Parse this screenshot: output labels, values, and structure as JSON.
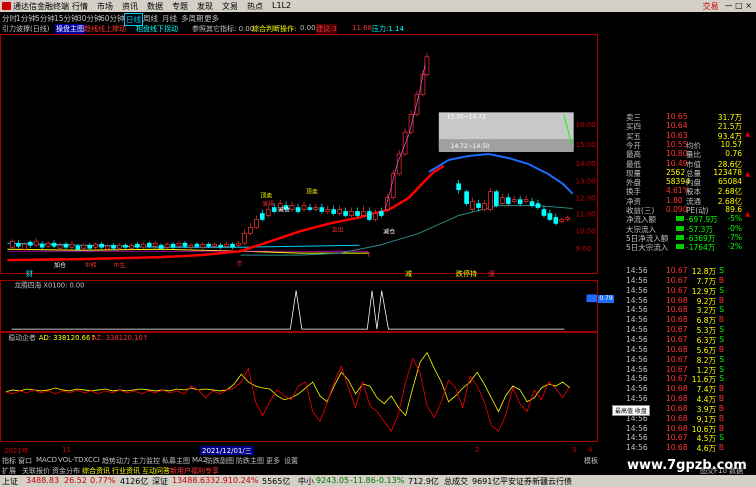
{
  "titlebar": {
    "app_title": "通达信金融终端",
    "menu": [
      "行情",
      "市场",
      "资讯",
      "数据",
      "专题",
      "发现",
      "文易",
      "热点",
      "L1L2"
    ],
    "right": "交易",
    "win_controls": "—  □  ×"
  },
  "periods": [
    "分时",
    "1分钟",
    "5分钟",
    "15分钟",
    "30分钟",
    "60分钟",
    "日线",
    "周线",
    "月线",
    "多周期",
    "更多"
  ],
  "selected_period": "日线",
  "indicator_bar": {
    "name": "引力波撑(日线)",
    "label1": "操盘主图",
    "label2": "趋线线上撑动",
    "label3": "相盘线下拐动",
    "label4": "参照其它指标: 0.00",
    "label5": "综合判断操作:",
    "label6": "0.00",
    "label7": "建议:3",
    "label8": "11.68",
    "label9": "压力:1.14"
  },
  "main_chart": {
    "price_axis": [
      "16.00",
      "15.00",
      "14.00",
      "13.00",
      "12.00",
      "11.00",
      "10.00",
      "9.00"
    ],
    "box1_label": "15.35~14.72",
    "box2_label": "14.72~14.50",
    "annotations": [
      "顶卖",
      "顶卖",
      "减仓",
      "波段",
      "减仓",
      "中转",
      "中生",
      "庄",
      "正出",
      "加仓"
    ],
    "bottom_labels": [
      "财",
      "减",
      "跌停持",
      "涨"
    ]
  },
  "sub1": {
    "title": "龙腾四海 X0100: 0.00",
    "axis": [
      "0.79"
    ]
  },
  "sub2": {
    "title": "稳动企者",
    "ad_label": "AD: 338120.66↑",
    "az_label": "AZ: 338120.10↑",
    "axis": [
      "10000",
      "5000",
      "0",
      "-5000"
    ]
  },
  "time_axis": {
    "left": "2021年",
    "mid1": "11",
    "mid2": "2021/12/01/三",
    "mid3": "2",
    "mid4": "3",
    "right": "4"
  },
  "quote": {
    "rows": [
      {
        "label": "卖三",
        "price": "10.65",
        "vol": "31.7万"
      },
      {
        "label": "买四",
        "price": "10.64",
        "vol": "21.5万"
      },
      {
        "label": "买五",
        "price": "10.63",
        "vol": "93.4万"
      },
      {
        "label": "今开",
        "price": "10.55",
        "label2": "均价",
        "val2": "10.57"
      },
      {
        "label": "最高",
        "price": "10.80",
        "label2": "量比",
        "val2": "0.76"
      },
      {
        "label": "最低",
        "price": "10.49",
        "label2": "市值",
        "val2": "28.6亿"
      },
      {
        "label": "现量",
        "price": "2562",
        "label2": "总量",
        "val2": "123478"
      },
      {
        "label": "外盘",
        "price": "58394",
        "label2": "内盘",
        "val2": "65084"
      },
      {
        "label": "换手",
        "price": "4.61%",
        "label2": "股本",
        "val2": "2.68亿"
      },
      {
        "label": "净资",
        "price": "1.80",
        "label2": "流通",
        "val2": "2.68亿"
      },
      {
        "label": "收益(三)",
        "price": "0.090",
        "label2": "PE(动)",
        "val2": "89.6"
      }
    ],
    "flows": [
      {
        "label": "净流入额",
        "val": "-697.9万",
        "pct": "-5%"
      },
      {
        "label": "大宗流入",
        "val": "-57.3万",
        "pct": "-0%"
      },
      {
        "label": "5日净流入额",
        "val": "-6369万",
        "pct": "-7%"
      },
      {
        "label": "5日大宗流入",
        "val": "-1764万",
        "pct": "-2%"
      }
    ]
  },
  "ticks": [
    {
      "time": "14:56",
      "price": "10.67",
      "vol": "12.8万",
      "dir": "S"
    },
    {
      "time": "14:56",
      "price": "10.67",
      "vol": "7.7万",
      "dir": "B"
    },
    {
      "time": "14:56",
      "price": "10.67",
      "vol": "12.9万",
      "dir": "S"
    },
    {
      "time": "14:56",
      "price": "10.68",
      "vol": "9.2万",
      "dir": "B"
    },
    {
      "time": "14:56",
      "price": "10.68",
      "vol": "3.2万",
      "dir": "S"
    },
    {
      "time": "14:56",
      "price": "10.68",
      "vol": "6.8万",
      "dir": "B"
    },
    {
      "time": "14:56",
      "price": "10.67",
      "vol": "5.3万",
      "dir": "S"
    },
    {
      "time": "14:56",
      "price": "10.67",
      "vol": "6.3万",
      "dir": "S"
    },
    {
      "time": "14:56",
      "price": "10.68",
      "vol": "5.6万",
      "dir": "B"
    },
    {
      "time": "14:56",
      "price": "10.67",
      "vol": "8.2万",
      "dir": "S"
    },
    {
      "time": "14:56",
      "price": "10.67",
      "vol": "1.2万",
      "dir": "S"
    },
    {
      "time": "14:56",
      "price": "10.67",
      "vol": "11.6万",
      "dir": "S"
    },
    {
      "time": "14:56",
      "price": "10.68",
      "vol": "7.4万",
      "dir": "B"
    },
    {
      "time": "14:56",
      "price": "10.68",
      "vol": "4.4万",
      "dir": "B"
    },
    {
      "time": "14:56",
      "price": "10.68",
      "vol": "3.9万",
      "dir": "B"
    },
    {
      "time": "14:56",
      "price": "10.68",
      "vol": "9.1万",
      "dir": "B"
    },
    {
      "time": "14:56",
      "price": "10.68",
      "vol": "10.6万",
      "dir": "B"
    },
    {
      "time": "14:56",
      "price": "10.67",
      "vol": "4.5万",
      "dir": "S"
    },
    {
      "time": "14:56",
      "price": "10.68",
      "vol": "4.6万",
      "dir": "B"
    }
  ],
  "tabs": [
    "指标",
    "窗口",
    "MACD",
    "VOL-TDX",
    "CCI",
    "趋势动力",
    "主力监控",
    "私募主图",
    "MA2",
    "防跌副图",
    "防跌主图",
    "更多",
    "设置"
  ],
  "tabs_right": "模板",
  "tabs2": [
    "扩展",
    "关联报价",
    "资金分布",
    "综合资讯",
    "行业资讯",
    "互动问答",
    "新用户福利专享"
  ],
  "tabs2_right": "图交F10 数据",
  "status": {
    "sh_label": "上证",
    "sh_val": "3488.83",
    "sh_chg": "26.52",
    "sh_pct": "0.77%",
    "sh_amt": "4126亿",
    "sz_label": "深证",
    "sz_val": "13488.63",
    "sz_chg": "32.91",
    "sz_pct": "0.24%",
    "sz_amt": "5565亿",
    "zx_label": "中小",
    "zx_val": "9243.05",
    "zx_chg": "-11.86",
    "zx_pct": "-0.13%",
    "zx_amt": "712.9亿",
    "hs_label": "总成交",
    "hs_amt": "9691亿",
    "broker": "平安证券新疆云行债"
  },
  "popup": "最高值 收盘",
  "watermark": "www.7gpzb.com",
  "colors": {
    "up": "#ff3232",
    "down": "#00ffff",
    "ma_red": "#ff0000",
    "ma_blue": "#1e6cff",
    "yellow": "#ffff00",
    "border": "#a00000"
  }
}
